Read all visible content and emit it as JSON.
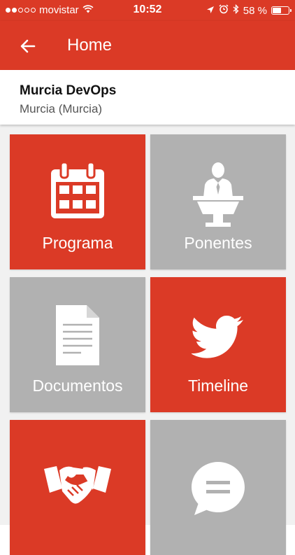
{
  "status_bar": {
    "carrier": "movistar",
    "signal_bars": 2,
    "time": "10:52",
    "battery_percent": "58 %",
    "battery_level": 0.58
  },
  "app_bar": {
    "back_icon": "arrow-left-icon",
    "title": "Home"
  },
  "event": {
    "name": "Murcia DevOps",
    "location": "Murcia (Murcia)"
  },
  "tiles": [
    {
      "label": "Programa",
      "icon": "calendar-icon",
      "color": "#db3a26"
    },
    {
      "label": "Ponentes",
      "icon": "speaker-podium-icon",
      "color": "#b1b1b1"
    },
    {
      "label": "Documentos",
      "icon": "document-icon",
      "color": "#b1b1b1"
    },
    {
      "label": "Timeline",
      "icon": "twitter-bird-icon",
      "color": "#db3a26"
    },
    {
      "label": "",
      "icon": "handshake-icon",
      "color": "#db3a26"
    },
    {
      "label": "",
      "icon": "chat-bubble-icon",
      "color": "#b1b1b1"
    }
  ],
  "colors": {
    "primary": "#db3a26",
    "tile_grey": "#b1b1b1",
    "grid_background": "#f1f1f1"
  }
}
